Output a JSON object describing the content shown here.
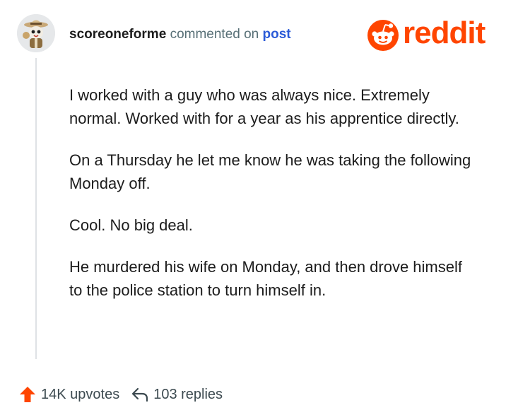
{
  "author": {
    "username": "scoreoneforme",
    "action_text": "commented on",
    "link_text": "post"
  },
  "brand": {
    "name": "reddit",
    "color": "#ff4500",
    "icon": "reddit-snoo-icon"
  },
  "comment": {
    "paragraphs": [
      "I worked with a guy who was always nice. Extremely normal. Worked with for a year as his apprentice directly.",
      "On a Thursday he let me know he was taking the following Monday off.",
      "Cool. No big deal.",
      "He murdered his wife on Monday, and then drove himself to the police station to turn himself in."
    ]
  },
  "footer": {
    "upvotes": "14K upvotes",
    "replies": "103 replies",
    "upvote_icon": "upvote-arrow-icon",
    "reply_icon": "reply-arrow-icon"
  },
  "colors": {
    "link": "#2a5ad7",
    "muted": "#576f76",
    "upvote": "#ff4500"
  }
}
